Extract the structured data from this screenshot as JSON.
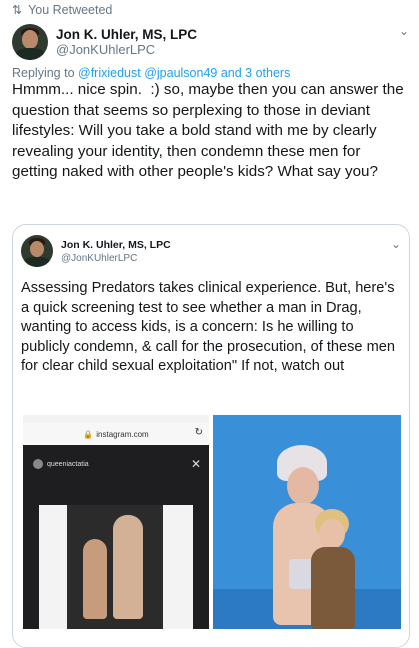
{
  "retweet": {
    "icon": "retweet-icon",
    "label": "You Retweeted"
  },
  "tweet": {
    "author_name": "Jon K. Uhler, MS, LPC",
    "author_handle": "@JonKUhlerLPC",
    "replying_label": "Replying to ",
    "replying_links": "@frixiedust @jpaulson49 and 3 others",
    "text": "Hmmm... nice spin.  :) so, maybe then you can answer the question that seems so perplexing to those in deviant lifestyles: Will you take a bold stand with me by clearly revealing your identity, then condemn these men for getting naked with other people's kids? What say you?"
  },
  "quoted_tweet": {
    "author_name": "Jon K. Uhler, MS, LPC",
    "author_handle": "@JonKUhlerLPC",
    "text": "Assessing Predators takes clinical experience. But, here's a quick screening test to see whether a man in Drag, wanting to access kids, is a concern: Is he willing to publicly condemn, & call for the prosecution, of these men for clear child sexual exploitation\" If not, watch out",
    "image_left": {
      "url_text": "instagram.com",
      "story_user": "queeniactatia"
    }
  },
  "colors": {
    "link": "#1da1f2",
    "secondary_text": "#657786",
    "border": "#ccd6dd"
  }
}
